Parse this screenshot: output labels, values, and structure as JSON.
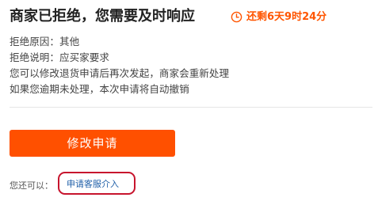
{
  "header": {
    "title": "商家已拒绝，您需要及时响应",
    "countdown_icon": "clock-icon",
    "countdown": "还剩6天9时24分"
  },
  "details": {
    "reason": "拒绝原因：其他",
    "explanation": "拒绝说明：应买家要求",
    "hint_1": "您可以修改退货申请后再次发起，商家会重新处理",
    "hint_2": "如果您逾期未处理，本次申请将自动撤销"
  },
  "actions": {
    "modify_label": "修改申请",
    "also_label": "您还可以：",
    "service_link": "申请客服介入"
  },
  "colors": {
    "accent": "#ff5000",
    "countdown": "#ff5500",
    "link": "#1f5fa8",
    "highlight": "#c7142d"
  }
}
